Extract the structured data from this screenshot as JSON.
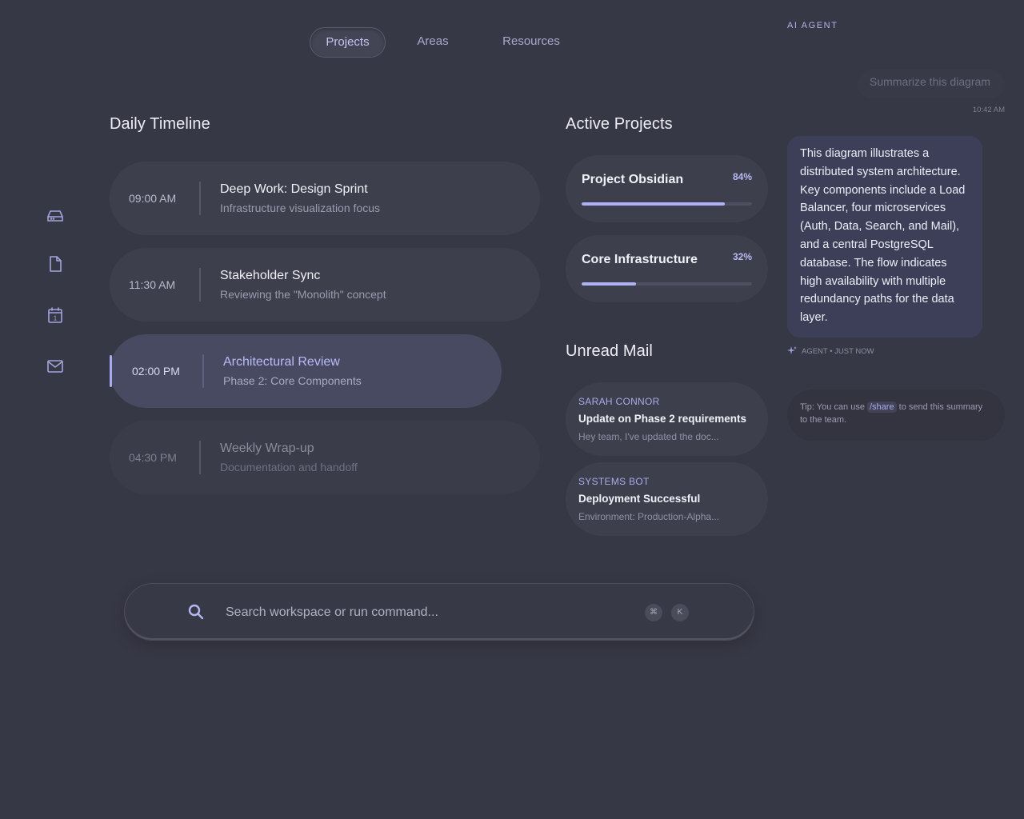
{
  "nav": {
    "tabs": [
      {
        "label": "Projects",
        "active": true
      },
      {
        "label": "Areas",
        "active": false
      },
      {
        "label": "Resources",
        "active": false
      }
    ]
  },
  "rail": {
    "icons": [
      "storage-icon",
      "document-icon",
      "calendar-icon",
      "mail-icon"
    ],
    "calendar_day": "1"
  },
  "timeline": {
    "title": "Daily Timeline",
    "items": [
      {
        "time": "09:00 AM",
        "title": "Deep Work: Design Sprint",
        "subtitle": "Infrastructure visualization focus"
      },
      {
        "time": "11:30 AM",
        "title": "Stakeholder Sync",
        "subtitle": "Reviewing the \"Monolith\" concept"
      },
      {
        "time": "02:00 PM",
        "title": "Architectural Review",
        "subtitle": "Phase 2: Core Components"
      },
      {
        "time": "04:30 PM",
        "title": "Weekly Wrap-up",
        "subtitle": "Documentation and handoff"
      }
    ]
  },
  "projects": {
    "title": "Active Projects",
    "items": [
      {
        "name": "Project Obsidian",
        "percent_label": "84%",
        "progress": 0.84
      },
      {
        "name": "Core Infrastructure",
        "percent_label": "32%",
        "progress": 0.32
      }
    ]
  },
  "mail": {
    "title": "Unread Mail",
    "items": [
      {
        "from": "SARAH CONNOR",
        "subject": "Update on Phase 2 requirements",
        "preview": "Hey team, I've updated the doc..."
      },
      {
        "from": "SYSTEMS BOT",
        "subject": "Deployment Successful",
        "preview": "Environment: Production-Alpha..."
      }
    ]
  },
  "search": {
    "placeholder": "Search workspace or run command...",
    "shortcut_keys": [
      "⌘",
      "K"
    ]
  },
  "agent": {
    "label": "AI AGENT",
    "user_message": "Summarize this diagram",
    "user_time": "10:42 AM",
    "response": "This diagram illustrates a distributed system architecture. Key components include a Load Balancer, four microservices (Auth, Data, Search, and Mail), and a central PostgreSQL database. The flow indicates high availability with multiple redundancy paths for the data layer.",
    "meta": "AGENT • JUST NOW",
    "tip_prefix": "Tip: You can use",
    "tip_code": "/share",
    "tip_suffix": "to send this summary to the team."
  },
  "colors": {
    "background": "#373845",
    "accent": "#aeb1f5",
    "card": "#3e3f4d"
  }
}
